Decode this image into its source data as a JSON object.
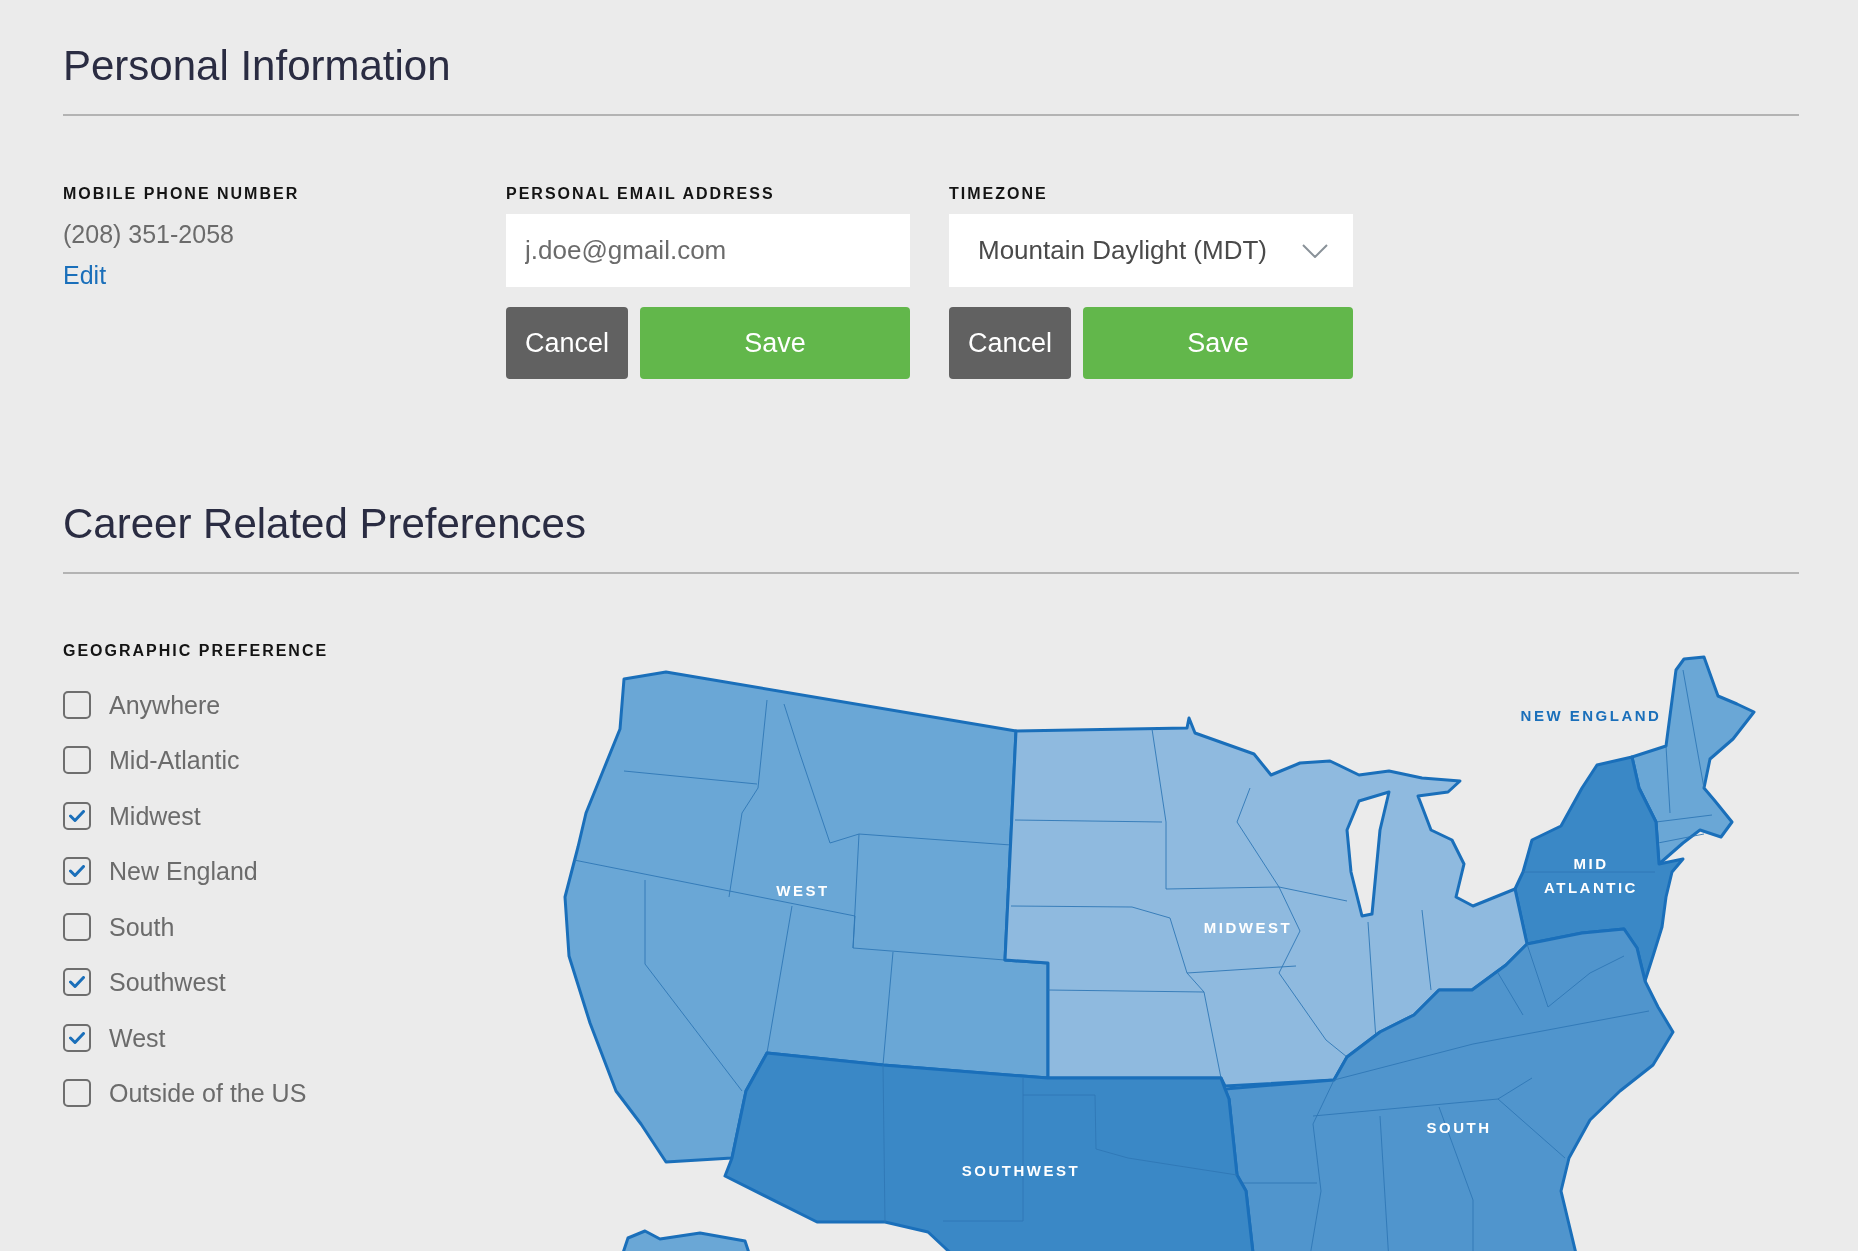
{
  "personal_information": {
    "title": "Personal Information",
    "mobile_phone": {
      "label": "MOBILE PHONE NUMBER",
      "value": "(208) 351-2058",
      "link": "Edit"
    },
    "email": {
      "label": "PERSONAL EMAIL ADDRESS",
      "value": "j.doe@gmail.com",
      "buttons": [
        {
          "label": "Cancel",
          "kind": "secondary"
        },
        {
          "label": "Save",
          "kind": "primary"
        }
      ]
    },
    "timezone": {
      "label": "TIMEZONE",
      "value": "Mountain Daylight (MDT)",
      "buttons": [
        {
          "label": "Cancel",
          "kind": "secondary"
        },
        {
          "label": "Save",
          "kind": "primary"
        }
      ]
    }
  },
  "career_preferences": {
    "title": "Career Related Preferences",
    "geographic_preference": {
      "label": "GEOGRAPHIC PREFERENCE",
      "options": [
        {
          "label": "Anywhere",
          "checked": false
        },
        {
          "label": "Mid-Atlantic",
          "checked": false
        },
        {
          "label": "Midwest",
          "checked": true
        },
        {
          "label": "New England",
          "checked": true
        },
        {
          "label": "South",
          "checked": false
        },
        {
          "label": "Southwest",
          "checked": true
        },
        {
          "label": "West",
          "checked": true
        },
        {
          "label": "Outside of the US",
          "checked": false
        }
      ]
    },
    "map": {
      "regions": [
        {
          "label": "NEW ENGLAND",
          "color": "#6aa7d6"
        },
        {
          "label": "WEST",
          "color": "#6aa7d6"
        },
        {
          "label": "MID ATLANTIC",
          "color": "#3a88c6"
        },
        {
          "label": "MIDWEST",
          "color": "#8fbadf"
        },
        {
          "label": "SOUTH",
          "color": "#5095cd"
        },
        {
          "label": "SOUTHWEST",
          "color": "#3a88c6"
        }
      ]
    }
  }
}
